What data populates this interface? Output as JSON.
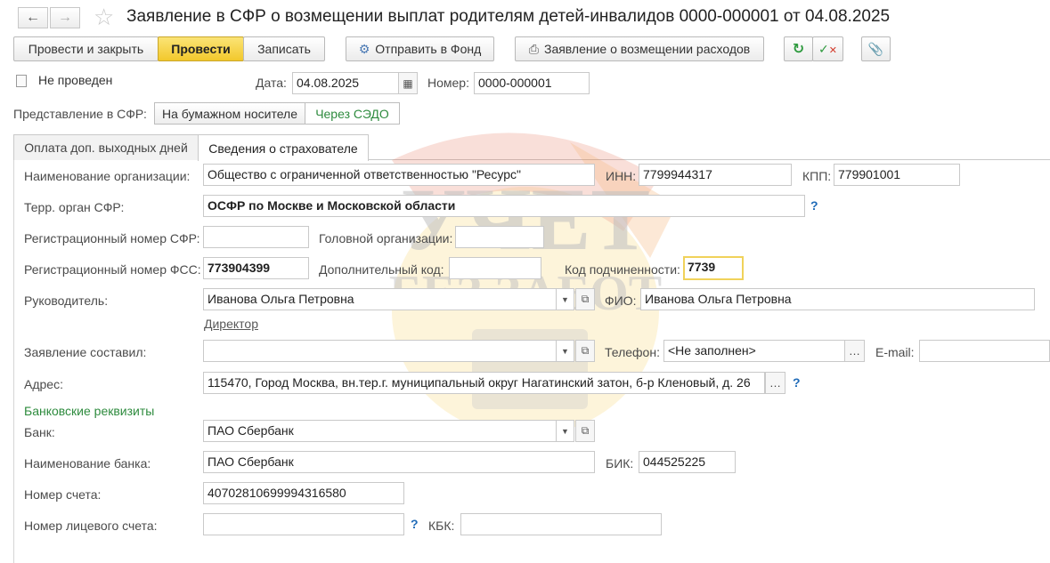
{
  "window": {
    "title": "Заявление в СФР о возмещении выплат родителям детей-инвалидов 0000-000001 от 04.08.2025"
  },
  "toolbar": {
    "post_close": "Провести и закрыть",
    "post": "Провести",
    "save": "Записать",
    "send": "Отправить в Фонд",
    "print_app": "Заявление о возмещении расходов"
  },
  "header": {
    "status": "Не проведен",
    "date_label": "Дата:",
    "date_value": "04.08.2025",
    "number_label": "Номер:",
    "number_value": "0000-000001"
  },
  "submission": {
    "label": "Представление в СФР:",
    "options": [
      "На бумажном носителе",
      "Через СЭДО"
    ]
  },
  "tabs": [
    "Оплата доп. выходных дней",
    "Сведения о страхователе"
  ],
  "form": {
    "org_name_label": "Наименование организации:",
    "org_name": "Общество с ограниченной ответственностью \"Ресурс\"",
    "inn_label": "ИНН:",
    "inn": "7799944317",
    "kpp_label": "КПП:",
    "kpp": "779901001",
    "sfr_body_label": "Терр. орган СФР:",
    "sfr_body": "ОСФР по Москве и Московской области",
    "reg_sfr_label": "Регистрационный номер СФР:",
    "reg_sfr": "",
    "head_org_label": "Головной организации:",
    "head_org": "",
    "reg_fss_label": "Регистрационный номер ФСС:",
    "reg_fss": "773904399",
    "extra_code_label": "Дополнительный код:",
    "extra_code": "",
    "subord_label": "Код подчиненности:",
    "subord": "7739",
    "manager_label": "Руководитель:",
    "manager": "Иванова Ольга Петровна",
    "fio_label": "ФИО:",
    "fio": "Иванова Ольга Петровна",
    "position_link": "Директор",
    "compiled_label": "Заявление составил:",
    "compiled": "",
    "phone_label": "Телефон:",
    "phone": "<Не заполнен>",
    "email_label": "E-mail:",
    "email": "",
    "address_label": "Адрес:",
    "address": "115470, Город Москва, вн.тер.г. муниципальный округ Нагатинский затон, б-р Кленовый, д. 26",
    "bank_section": "Банковские реквизиты",
    "bank_label": "Банк:",
    "bank": "ПАО Сбербанк",
    "bank_name_label": "Наименование банка:",
    "bank_name": "ПАО Сбербанк",
    "bik_label": "БИК:",
    "bik": "044525225",
    "account_label": "Номер счета:",
    "account": "40702810699994316580",
    "personal_account_label": "Номер лицевого счета:",
    "personal_account": "",
    "kbk_label": "КБК:",
    "kbk": ""
  },
  "watermark": {
    "line1": "УЧЕТ",
    "line2": "БЕЗ ЗАБОТ"
  },
  "colors": {
    "primary_button": "#f2c82c",
    "section_heading": "#2e8b3e",
    "help_icon": "#1f6bb8"
  }
}
